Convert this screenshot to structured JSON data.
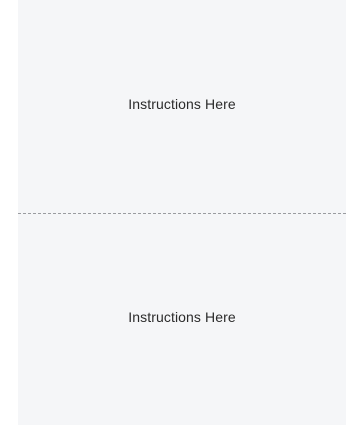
{
  "top_panel": {
    "instruction_text": "Instructions Here"
  },
  "bottom_panel": {
    "instruction_text": "Instructions Here"
  },
  "colors": {
    "card_background": "#f5f6f8",
    "divider": "#9a9ca0",
    "text": "#2b2b2b"
  }
}
